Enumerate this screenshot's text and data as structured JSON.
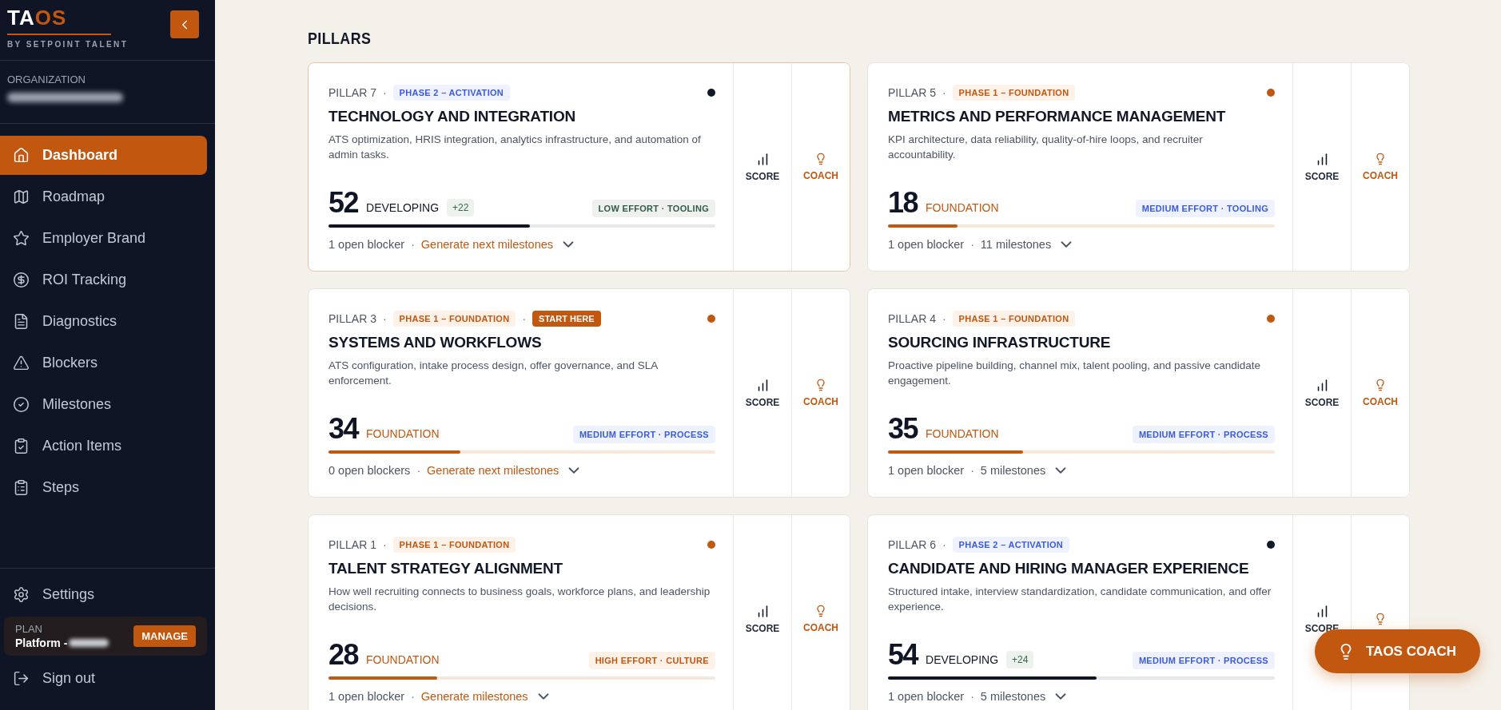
{
  "sidebar": {
    "logo": [
      {
        "text": "TA",
        "kind": "light"
      },
      {
        "text": "OS",
        "kind": "accent"
      }
    ],
    "tagline": "BY SETPOINT TALENT",
    "organization_label": "ORGANIZATION",
    "nav": [
      {
        "label": "Dashboard",
        "kind": "home",
        "selected": true
      },
      {
        "label": "Roadmap",
        "kind": "map",
        "selected": false
      },
      {
        "label": "Employer Brand",
        "kind": "star",
        "selected": false
      },
      {
        "label": "ROI Tracking",
        "kind": "dollar",
        "selected": false
      },
      {
        "label": "Diagnostics",
        "kind": "file",
        "selected": false
      },
      {
        "label": "Blockers",
        "kind": "alert",
        "selected": false
      },
      {
        "label": "Milestones",
        "kind": "check",
        "selected": false
      },
      {
        "label": "Action Items",
        "kind": "clipboard-check",
        "selected": false
      },
      {
        "label": "Steps",
        "kind": "clipboard-list",
        "selected": false
      }
    ],
    "settings": "Settings",
    "plan": {
      "label": "PLAN",
      "name": "Platform -",
      "button": "MANAGE"
    },
    "sign_out": "Sign out"
  },
  "section_title": "PILLARS",
  "cards": [
    {
      "pillar": "PILLAR 7",
      "pillar_separator": "·",
      "phase": {
        "label": "PHASE 2 – ACTIVATION",
        "kind": "activation"
      },
      "selected": true,
      "color": "#111827",
      "title": "TECHNOLOGY AND INTEGRATION",
      "description": "ATS optimization, HRIS integration, analytics infrastructure, and automation of admin tasks.",
      "score": "52",
      "stage": {
        "label": "DEVELOPING",
        "kind": "developing"
      },
      "delta": "+22",
      "effort": {
        "label": "LOW EFFORT · TOOLING",
        "kind": "low"
      },
      "level": 0.52,
      "blockers": "1 open blocker",
      "footer_separator": "·",
      "milestones": {
        "label": "Generate next milestones",
        "kind": "link"
      },
      "actions": [
        {
          "label": "SCORE",
          "kind": "score"
        },
        {
          "label": "COACH",
          "kind": "coach"
        }
      ]
    },
    {
      "pillar": "PILLAR 5",
      "pillar_separator": "·",
      "phase": {
        "label": "PHASE 1 – FOUNDATION",
        "kind": "foundation"
      },
      "selected": false,
      "color": "#c2570f",
      "title": "METRICS AND PERFORMANCE MANAGEMENT",
      "description": "KPI architecture, data reliability, quality-of-hire loops, and recruiter accountability.",
      "score": "18",
      "stage": {
        "label": "FOUNDATION",
        "kind": "foundation"
      },
      "effort": {
        "label": "MEDIUM EFFORT · TOOLING",
        "kind": "medium"
      },
      "level": 0.18,
      "blockers": "1 open blocker",
      "footer_separator": "·",
      "milestones": {
        "label": "11 milestones",
        "kind": "text"
      },
      "actions": [
        {
          "label": "SCORE",
          "kind": "score"
        },
        {
          "label": "COACH",
          "kind": "coach"
        }
      ]
    },
    {
      "pillar": "PILLAR 3",
      "pillar_separator": "·",
      "phase": {
        "label": "PHASE 1 – FOUNDATION",
        "kind": "foundation"
      },
      "badge_separator": "·",
      "start_badge": "START HERE",
      "selected": false,
      "color": "#c2570f",
      "title": "SYSTEMS AND WORKFLOWS",
      "description": "ATS configuration, intake process design, offer governance, and SLA enforcement.",
      "score": "34",
      "stage": {
        "label": "FOUNDATION",
        "kind": "foundation"
      },
      "effort": {
        "label": "MEDIUM EFFORT · PROCESS",
        "kind": "medium"
      },
      "level": 0.34,
      "blockers": "0 open blockers",
      "footer_separator": "·",
      "milestones": {
        "label": "Generate next milestones",
        "kind": "link"
      },
      "actions": [
        {
          "label": "SCORE",
          "kind": "score"
        },
        {
          "label": "COACH",
          "kind": "coach"
        }
      ]
    },
    {
      "pillar": "PILLAR 4",
      "pillar_separator": "·",
      "phase": {
        "label": "PHASE 1 – FOUNDATION",
        "kind": "foundation"
      },
      "selected": false,
      "color": "#c2570f",
      "title": "SOURCING INFRASTRUCTURE",
      "description": "Proactive pipeline building, channel mix, talent pooling, and passive candidate engagement.",
      "score": "35",
      "stage": {
        "label": "FOUNDATION",
        "kind": "foundation"
      },
      "effort": {
        "label": "MEDIUM EFFORT · PROCESS",
        "kind": "medium"
      },
      "level": 0.35,
      "blockers": "1 open blocker",
      "footer_separator": "·",
      "milestones": {
        "label": "5 milestones",
        "kind": "text"
      },
      "actions": [
        {
          "label": "SCORE",
          "kind": "score"
        },
        {
          "label": "COACH",
          "kind": "coach"
        }
      ]
    },
    {
      "pillar": "PILLAR 1",
      "pillar_separator": "·",
      "phase": {
        "label": "PHASE 1 – FOUNDATION",
        "kind": "foundation"
      },
      "selected": false,
      "color": "#c2570f",
      "title": "TALENT STRATEGY ALIGNMENT",
      "description": "How well recruiting connects to business goals, workforce plans, and leadership decisions.",
      "score": "28",
      "stage": {
        "label": "FOUNDATION",
        "kind": "foundation"
      },
      "effort": {
        "label": "HIGH EFFORT · CULTURE",
        "kind": "high"
      },
      "level": 0.28,
      "blockers": "1 open blocker",
      "footer_separator": "·",
      "milestones": {
        "label": "Generate milestones",
        "kind": "link"
      },
      "actions": [
        {
          "label": "SCORE",
          "kind": "score"
        },
        {
          "label": "COACH",
          "kind": "coach"
        }
      ]
    },
    {
      "pillar": "PILLAR 6",
      "pillar_separator": "·",
      "phase": {
        "label": "PHASE 2 – ACTIVATION",
        "kind": "activation"
      },
      "selected": false,
      "color": "#111827",
      "title": "CANDIDATE AND HIRING MANAGER EXPERIENCE",
      "description": "Structured intake, interview standardization, candidate communication, and offer experience.",
      "score": "54",
      "stage": {
        "label": "DEVELOPING",
        "kind": "developing"
      },
      "delta": "+24",
      "effort": {
        "label": "MEDIUM EFFORT · PROCESS",
        "kind": "medium"
      },
      "level": 0.54,
      "blockers": "1 open blocker",
      "footer_separator": "·",
      "milestones": {
        "label": "5 milestones",
        "kind": "text"
      },
      "actions": [
        {
          "label": "SCORE",
          "kind": "score"
        },
        {
          "kind": "coach"
        }
      ]
    }
  ],
  "coach_button": "TAOS COACH"
}
